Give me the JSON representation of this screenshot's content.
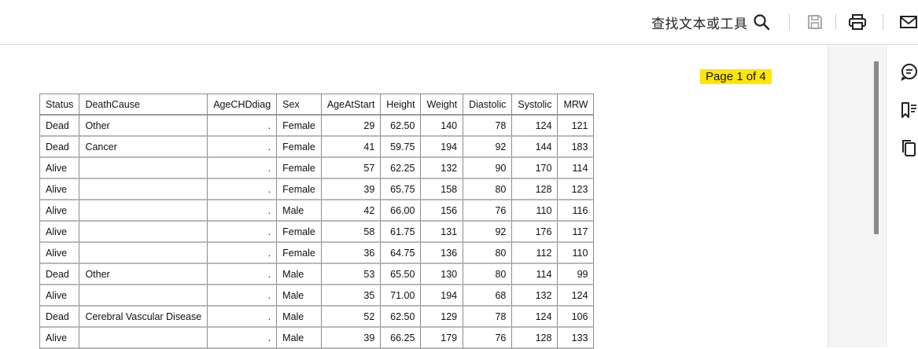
{
  "toolbar": {
    "find_label": "查找文本或工具",
    "icons": [
      "search-icon",
      "save-icon",
      "print-icon",
      "mail-icon"
    ]
  },
  "page_indicator": "Page 1 of 4",
  "rail": {
    "icons": [
      "comment-icon",
      "bookmark-icon",
      "copy-icon"
    ]
  },
  "colors": {
    "page_highlight": "#ffe600",
    "save_disabled": "#a0a0a0"
  },
  "table": {
    "headers": [
      "Status",
      "DeathCause",
      "AgeCHDdiag",
      "Sex",
      "AgeAtStart",
      "Height",
      "Weight",
      "Diastolic",
      "Systolic",
      "MRW"
    ],
    "rows": [
      [
        "Dead",
        "Other",
        ".",
        "Female",
        "29",
        "62.50",
        "140",
        "78",
        "124",
        "121"
      ],
      [
        "Dead",
        "Cancer",
        ".",
        "Female",
        "41",
        "59.75",
        "194",
        "92",
        "144",
        "183"
      ],
      [
        "Alive",
        "",
        ".",
        "Female",
        "57",
        "62.25",
        "132",
        "90",
        "170",
        "114"
      ],
      [
        "Alive",
        "",
        ".",
        "Female",
        "39",
        "65.75",
        "158",
        "80",
        "128",
        "123"
      ],
      [
        "Alive",
        "",
        ".",
        "Male",
        "42",
        "66.00",
        "156",
        "76",
        "110",
        "116"
      ],
      [
        "Alive",
        "",
        ".",
        "Female",
        "58",
        "61.75",
        "131",
        "92",
        "176",
        "117"
      ],
      [
        "Alive",
        "",
        ".",
        "Female",
        "36",
        "64.75",
        "136",
        "80",
        "112",
        "110"
      ],
      [
        "Dead",
        "Other",
        ".",
        "Male",
        "53",
        "65.50",
        "130",
        "80",
        "114",
        "99"
      ],
      [
        "Alive",
        "",
        ".",
        "Male",
        "35",
        "71.00",
        "194",
        "68",
        "132",
        "124"
      ],
      [
        "Dead",
        "Cerebral Vascular Disease",
        ".",
        "Male",
        "52",
        "62.50",
        "129",
        "78",
        "124",
        "106"
      ],
      [
        "Alive",
        "",
        ".",
        "Male",
        "39",
        "66.25",
        "179",
        "76",
        "128",
        "133"
      ]
    ]
  }
}
